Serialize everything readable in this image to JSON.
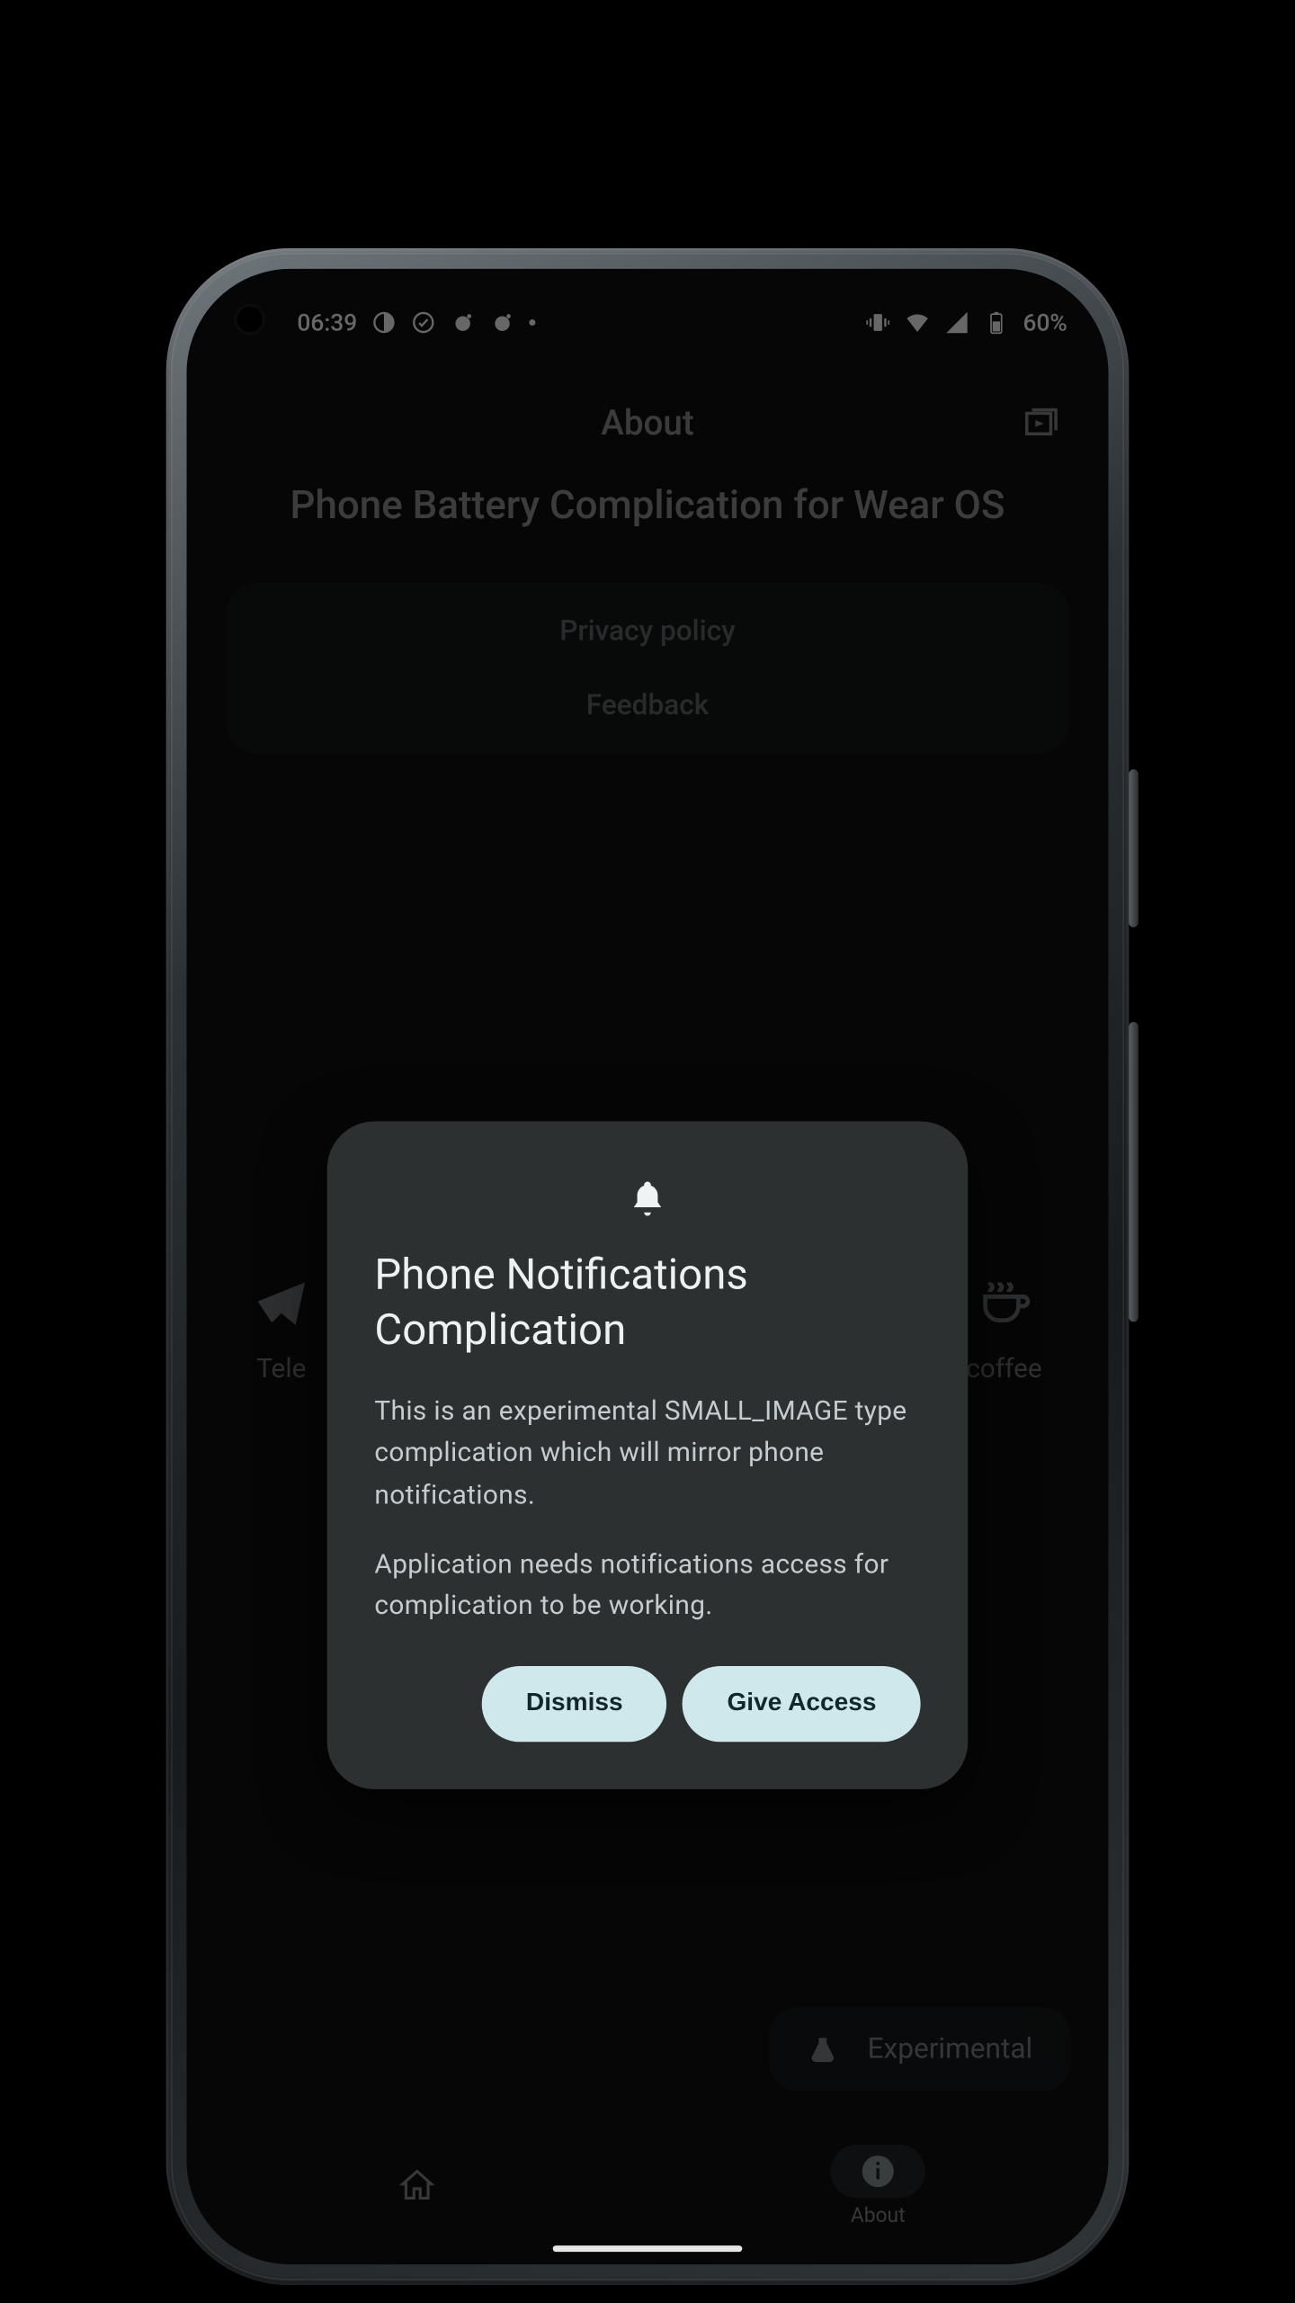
{
  "statusbar": {
    "time": "06:39",
    "battery_text": "60%"
  },
  "toolbar": {
    "title": "About"
  },
  "app": {
    "title": "Phone Battery Complication for Wear OS"
  },
  "card": {
    "privacy": "Privacy policy",
    "feedback": "Feedback"
  },
  "social": {
    "left_label": "Tele",
    "right_label": "coffee"
  },
  "chip": {
    "label": "Experimental"
  },
  "nav": {
    "about_label": "About"
  },
  "dialog": {
    "title": "Phone Notifications Complication",
    "body1": "This is an experimental SMALL_IMAGE type complication which will mirror phone notifications.",
    "body2": "Application needs notifications access for complication to be working.",
    "dismiss": "Dismiss",
    "give_access": "Give Access"
  }
}
